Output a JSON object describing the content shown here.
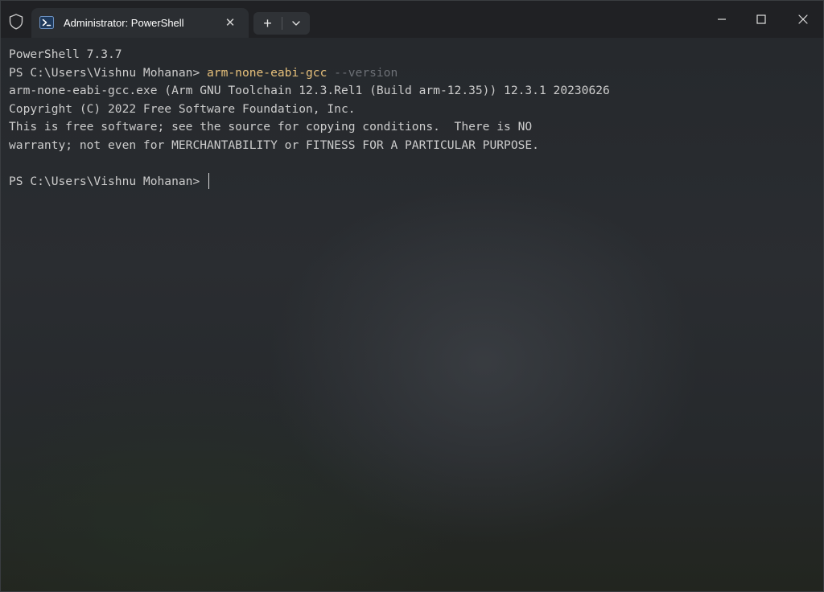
{
  "titlebar": {
    "tab_title": "Administrator: PowerShell",
    "close_tab_label": "✕",
    "new_tab_label": "+"
  },
  "terminal": {
    "version_line": "PowerShell 7.3.7",
    "prompt_1": "PS C:\\Users\\Vishnu Mohanan> ",
    "command": "arm-none-eabi-gcc",
    "command_param": " --version",
    "output_1": "arm-none-eabi-gcc.exe (Arm GNU Toolchain 12.3.Rel1 (Build arm-12.35)) 12.3.1 20230626",
    "output_2": "Copyright (C) 2022 Free Software Foundation, Inc.",
    "output_3": "This is free software; see the source for copying conditions.  There is NO",
    "output_4": "warranty; not even for MERCHANTABILITY or FITNESS FOR A PARTICULAR PURPOSE.",
    "prompt_2": "PS C:\\Users\\Vishnu Mohanan> "
  },
  "colors": {
    "text": "#cccccc",
    "command": "#e6c07b",
    "parameter": "#6c7076",
    "titlebar": "#202124",
    "tab_active": "#2b2e32"
  },
  "icons": {
    "admin": "shield-icon",
    "tab": "powershell-icon",
    "dropdown": "chevron-down-icon",
    "minimize": "minimize-icon",
    "maximize": "maximize-icon",
    "close": "close-icon"
  }
}
